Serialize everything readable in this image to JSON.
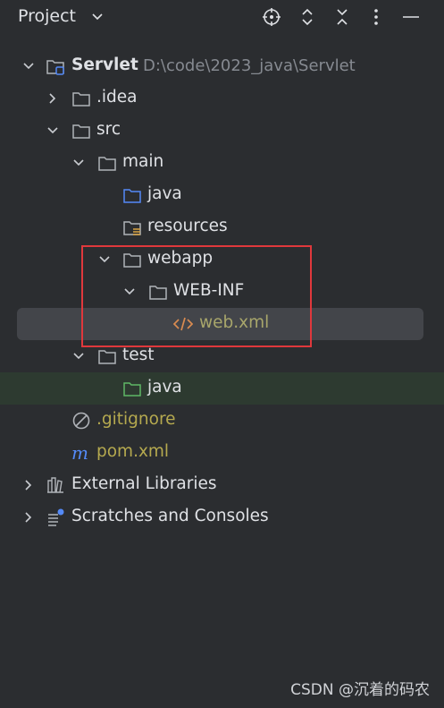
{
  "header": {
    "title": "Project",
    "icons": [
      "locate-icon",
      "expand-collapse-icon",
      "collapse-all-icon",
      "more-options-icon",
      "minimize-icon"
    ]
  },
  "tree": {
    "root": {
      "label": "Servlet",
      "path": "D:\\code\\2023_java\\Servlet"
    },
    "idea": ".idea",
    "src": "src",
    "main": "main",
    "main_java": "java",
    "resources": "resources",
    "webapp": "webapp",
    "webinf": "WEB-INF",
    "webxml": "web.xml",
    "test": "test",
    "test_java": "java",
    "gitignore": ".gitignore",
    "pom": "pom.xml",
    "external_libraries": "External Libraries",
    "scratches": "Scratches and Consoles"
  },
  "colors": {
    "background": "#2b2d30",
    "selection": "#43454a",
    "annotation": "#e0383c",
    "folder": "#b0b3b8",
    "source_folder": "#548af7",
    "test_folder": "#5fb865",
    "xml": "#d98b50"
  },
  "watermark": "CSDN @沉着的码农"
}
